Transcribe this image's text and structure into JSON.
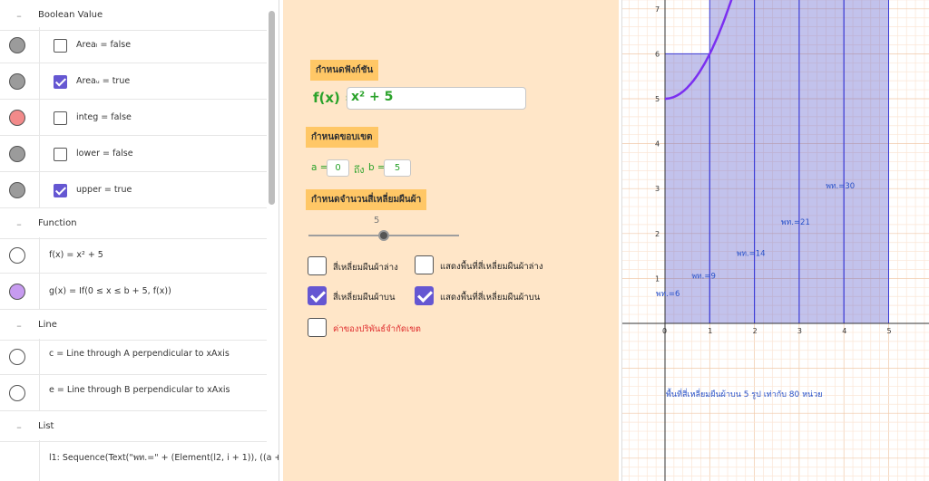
{
  "algebra": {
    "groups": {
      "boolean": "Boolean Value",
      "function": "Function",
      "line": "Line",
      "list": "List"
    },
    "items": {
      "area_l": "Areaₗ = false",
      "area_u": "Areaᵤ = true",
      "integ": "integ = false",
      "lower": "lower = false",
      "upper": "upper = true",
      "f": "f(x) = x² + 5",
      "g": "g(x) = If(0 ≤ x ≤ b + 5, f(x))",
      "c": "c = Line through A perpendicular to xAxis",
      "e": "e = Line through B perpendicular to xAxis",
      "l1": "l1: Sequence(Text(\"พท.=\" + (Element(l2, i + 1)), ((a +"
    },
    "colors": {
      "gray": "#9b9b9b",
      "red": "#f28a8a",
      "purple": "#c79bf0"
    }
  },
  "panel": {
    "function_heading": "กำหนดฟังก์ชัน",
    "fx_label": "f(x) =",
    "fx_value": "x² + 5",
    "bounds_heading": "กำหนดขอบเขต",
    "a_label": "a =",
    "a_value": "0",
    "to_label": "ถึง",
    "b_label": "b =",
    "b_value": "5",
    "rect_heading": "กำหนดจำนวนสี่เหลี่ยมผืนผ้า",
    "slider_value": "5",
    "cb_lower_rect": "สี่เหลี่ยมผืนผ้าล่าง",
    "cb_lower_area": "แสดงพื้นที่สี่เหลี่ยมผืนผ้าล่าง",
    "cb_upper_rect": "สี่เหลี่ยมผืนผ้าบน",
    "cb_upper_area": "แสดงพื้นที่สี่เหลี่ยมผืนผ้าบน",
    "cb_integral": "ค่าของปริพันธ์จำกัดเขต",
    "integral_color": "#e03030",
    "accent": "#6557d2"
  },
  "graph": {
    "x_ticks": [
      "0",
      "1",
      "2",
      "3",
      "4",
      "5"
    ],
    "y_ticks": [
      "1",
      "2",
      "3",
      "4",
      "5",
      "6",
      "7"
    ],
    "labels": [
      "พท.=6",
      "พท.=9",
      "พท.=14",
      "พท.=21",
      "พท.=30"
    ],
    "area_text": "พื้นที่สี่เหลี่ยมผืนผ้าบน 5 รูป เท่ากับ 80 หน่วย",
    "curve_color": "#7b2ff0",
    "label_color": "#2750c8"
  }
}
